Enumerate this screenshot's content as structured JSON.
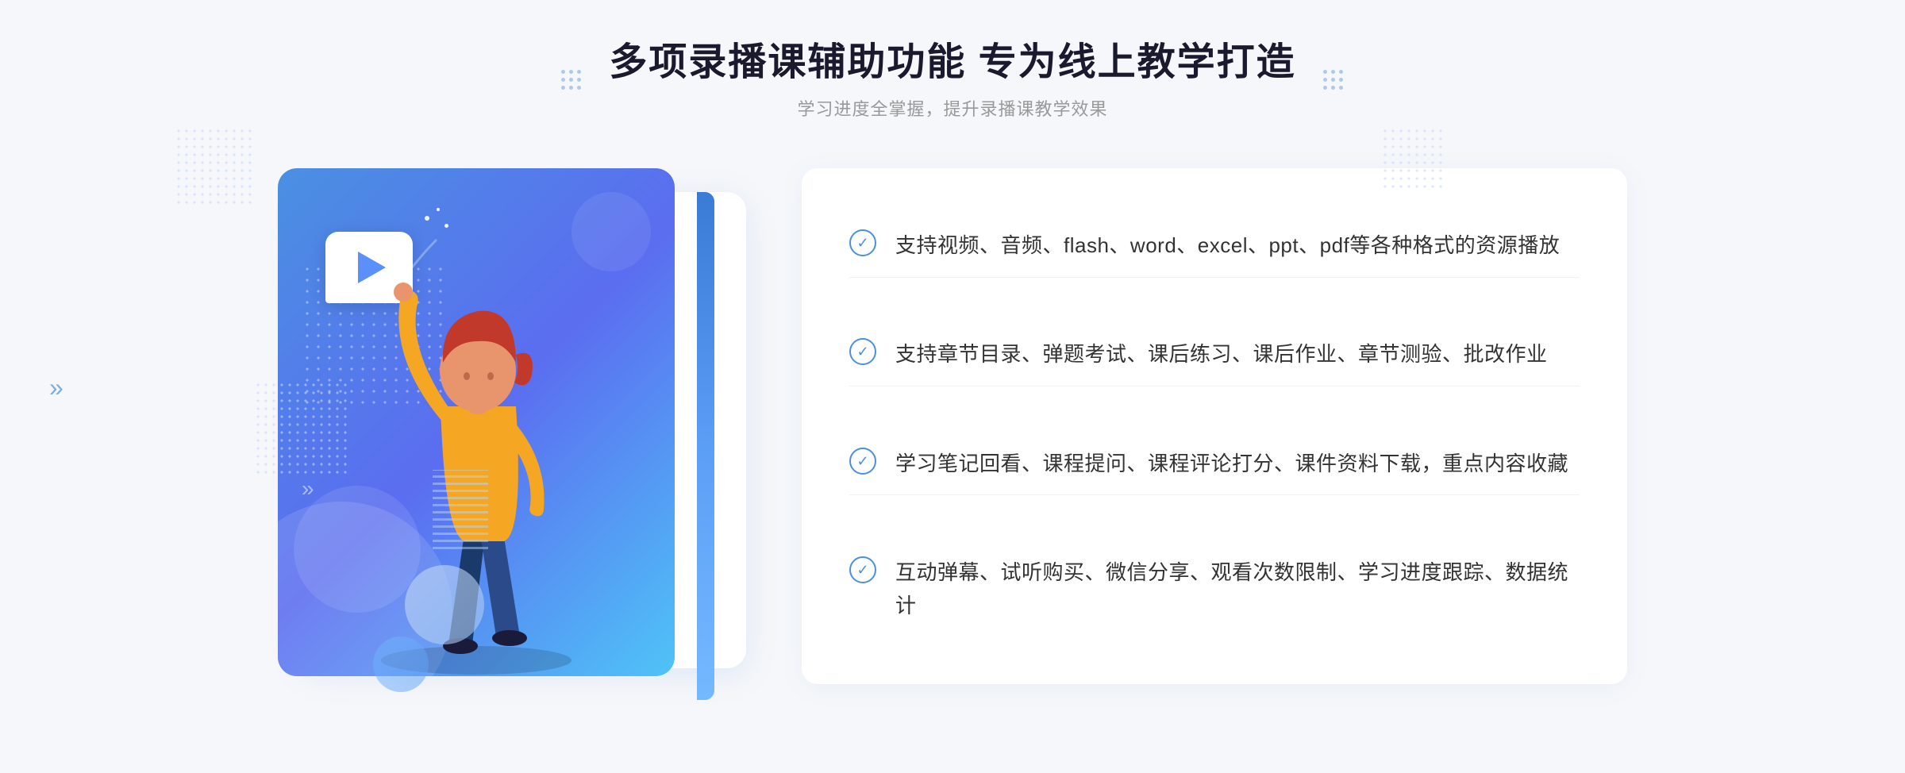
{
  "header": {
    "main_title": "多项录播课辅助功能 专为线上教学打造",
    "subtitle": "学习进度全掌握，提升录播课教学效果",
    "decoration_dots_left": "decoration-dots-left",
    "decoration_dots_right": "decoration-dots-right"
  },
  "features": [
    {
      "id": "feature-1",
      "text": "支持视频、音频、flash、word、excel、ppt、pdf等各种格式的资源播放"
    },
    {
      "id": "feature-2",
      "text": "支持章节目录、弹题考试、课后练习、课后作业、章节测验、批改作业"
    },
    {
      "id": "feature-3",
      "text": "学习笔记回看、课程提问、课程评论打分、课件资料下载，重点内容收藏"
    },
    {
      "id": "feature-4",
      "text": "互动弹幕、试听购买、微信分享、观看次数限制、学习进度跟踪、数据统计"
    }
  ],
  "icons": {
    "check": "✓",
    "play": "▶",
    "chevron_double": "»"
  },
  "colors": {
    "blue_primary": "#4a90e2",
    "blue_gradient_start": "#4a90e2",
    "blue_gradient_end": "#5b6df0",
    "text_dark": "#1a1a2e",
    "text_gray": "#999999",
    "text_body": "#333333",
    "white": "#ffffff",
    "bg": "#f5f7fa"
  }
}
